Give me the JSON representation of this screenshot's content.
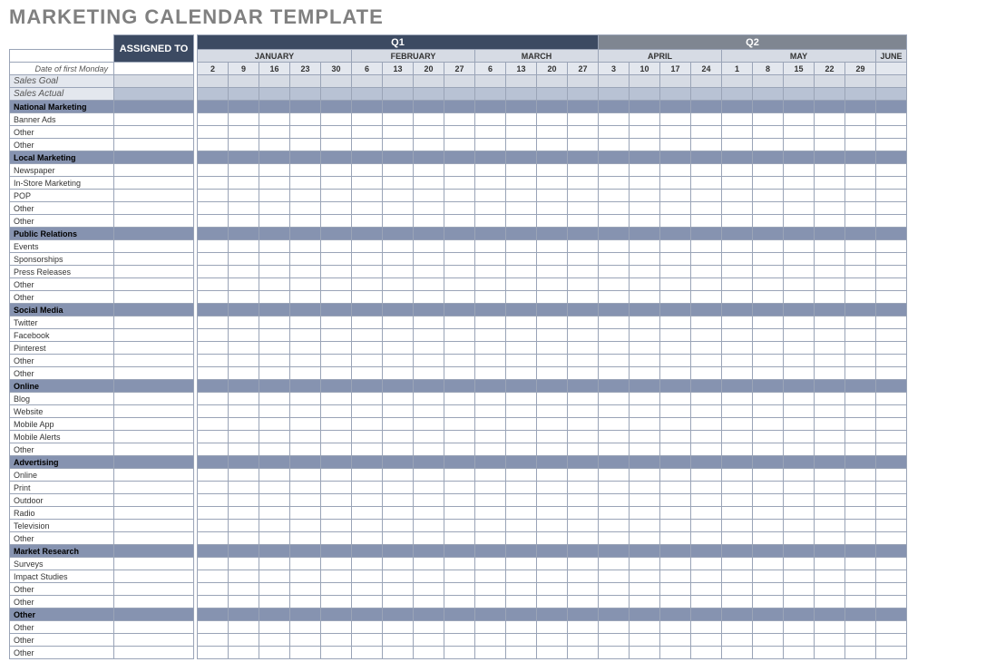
{
  "title": "MARKETING CALENDAR TEMPLATE",
  "headers": {
    "assigned_to": "ASSIGNED TO",
    "date_of_first_monday": "Date of first Monday",
    "sales_goal": "Sales Goal",
    "sales_actual": "Sales Actual"
  },
  "quarters": [
    {
      "label": "Q1",
      "months": [
        {
          "name": "JANUARY",
          "weeks": [
            "2",
            "9",
            "16",
            "23",
            "30"
          ]
        },
        {
          "name": "FEBRUARY",
          "weeks": [
            "6",
            "13",
            "20",
            "27"
          ]
        },
        {
          "name": "MARCH",
          "weeks": [
            "6",
            "13",
            "20",
            "27"
          ]
        }
      ]
    },
    {
      "label": "Q2",
      "months": [
        {
          "name": "APRIL",
          "weeks": [
            "3",
            "10",
            "17",
            "24"
          ]
        },
        {
          "name": "MAY",
          "weeks": [
            "1",
            "8",
            "15",
            "22",
            "29"
          ]
        },
        {
          "name": "JUNE",
          "weeks": [
            ""
          ]
        }
      ]
    }
  ],
  "categories": [
    {
      "name": "National Marketing",
      "items": [
        "Banner Ads",
        "Other",
        "Other"
      ]
    },
    {
      "name": "Local Marketing",
      "items": [
        "Newspaper",
        "In-Store Marketing",
        "POP",
        "Other",
        "Other"
      ]
    },
    {
      "name": "Public Relations",
      "items": [
        "Events",
        "Sponsorships",
        "Press Releases",
        "Other",
        "Other"
      ]
    },
    {
      "name": "Social Media",
      "items": [
        "Twitter",
        "Facebook",
        "Pinterest",
        "Other",
        "Other"
      ]
    },
    {
      "name": "Online",
      "items": [
        "Blog",
        "Website",
        "Mobile App",
        "Mobile Alerts",
        "Other"
      ]
    },
    {
      "name": "Advertising",
      "items": [
        "Online",
        "Print",
        "Outdoor",
        "Radio",
        "Television",
        "Other"
      ]
    },
    {
      "name": "Market Research",
      "items": [
        "Surveys",
        "Impact Studies",
        "Other",
        "Other"
      ]
    },
    {
      "name": "Other",
      "items": [
        "Other",
        "Other",
        "Other"
      ]
    }
  ]
}
